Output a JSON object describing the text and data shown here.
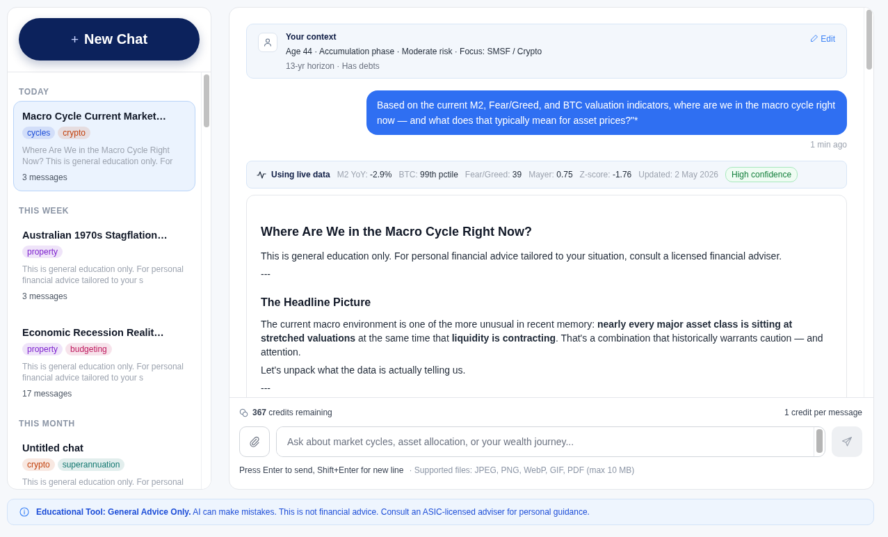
{
  "sidebar": {
    "new_chat_button": {
      "icon": "+",
      "label": "New Chat"
    },
    "sections": [
      {
        "title": "TODAY",
        "chats": [
          {
            "title": "Macro Cycle Current Market…",
            "selected": true,
            "tags": [
              {
                "label": "cycles",
                "color": "#1d4ed8"
              },
              {
                "label": "crypto",
                "color": "#c2410c"
              }
            ],
            "preview": "Where Are We in the Macro Cycle Right Now? This is general education only. For",
            "count": "3 messages"
          }
        ]
      },
      {
        "title": "THIS WEEK",
        "chats": [
          {
            "title": "Australian 1970s Stagflation…",
            "selected": false,
            "tags": [
              {
                "label": "property",
                "color": "#7e22ce"
              }
            ],
            "preview": "This is general education only. For personal financial advice tailored to your s",
            "count": "3 messages"
          },
          {
            "title": "Economic Recession Realit…",
            "selected": false,
            "tags": [
              {
                "label": "property",
                "color": "#7e22ce"
              },
              {
                "label": "budgeting",
                "color": "#be185d"
              }
            ],
            "preview": "This is general education only. For personal financial advice tailored to your s",
            "count": "17 messages"
          }
        ]
      },
      {
        "title": "THIS MONTH",
        "chats": [
          {
            "title": "Untitled chat",
            "selected": false,
            "tags": [
              {
                "label": "crypto",
                "color": "#c2410c"
              },
              {
                "label": "superannuation",
                "color": "#0f766e"
              }
            ],
            "preview": "This is general education only. For personal"
          }
        ]
      }
    ]
  },
  "context": {
    "title": "Your context",
    "line_1": "Age 44 · Accumulation phase · Moderate risk · Focus: SMSF / Crypto",
    "line_2": "13-yr horizon · Has debts",
    "edit": "Edit"
  },
  "user_message": {
    "text": "Based on the current M2, Fear/Greed, and BTC valuation indicators, where are we in the macro cycle right now — and what does that typically mean for asset prices?\"*",
    "time": "1 min ago"
  },
  "live_data": {
    "label": "Using live data",
    "metrics": [
      {
        "kind": "metric",
        "label": "M2 YoY:",
        "value": "-2.9%"
      },
      {
        "kind": "metric",
        "label": "BTC:",
        "value": "99th pctile"
      },
      {
        "kind": "metric",
        "label": "Fear/Greed:",
        "value": "39"
      },
      {
        "kind": "metric",
        "label": "Mayer:",
        "value": "0.75"
      },
      {
        "kind": "metric",
        "label": "Z-score:",
        "value": "-1.76"
      },
      {
        "kind": "note",
        "label": "Updated: 2 May 2026"
      }
    ],
    "confidence": "High confidence"
  },
  "assistant_message": {
    "blocks": [
      {
        "kind": "heading",
        "text": "Where Are We in the Macro Cycle Right Now?"
      },
      {
        "kind": "paragraph",
        "text": "This is general education only. For personal financial advice tailored to your situation, consult a licensed financial adviser."
      },
      {
        "kind": "rule",
        "text": "---"
      },
      {
        "kind": "subheading",
        "text": "The Headline Picture"
      },
      {
        "kind": "paragraph",
        "text": "The current macro environment is one of the more unusual in recent memory: **nearly every major asset class is sitting at stretched valuations** at the same time that **liquidity is contracting**. That's a combination that historically warrants caution — and attention."
      },
      {
        "kind": "paragraph",
        "text": "Let's unpack what the data is actually telling us."
      },
      {
        "kind": "rule",
        "text": "---"
      }
    ]
  },
  "composer": {
    "credits": "**367** credits remaining",
    "cost": "1 credit per message",
    "placeholder": "Ask about market cycles, asset allocation, or your wealth journey...",
    "hint": "Press Enter to send, Shift+Enter for new line",
    "files": "· Supported files: JPEG, PNG, WebP, GIF, PDF (max 10 MB)"
  },
  "banner": {
    "text": "**Educational Tool: General Advice Only.** AI can make mistakes. This is not financial advice. Consult an ASIC-licensed adviser for personal guidance."
  }
}
